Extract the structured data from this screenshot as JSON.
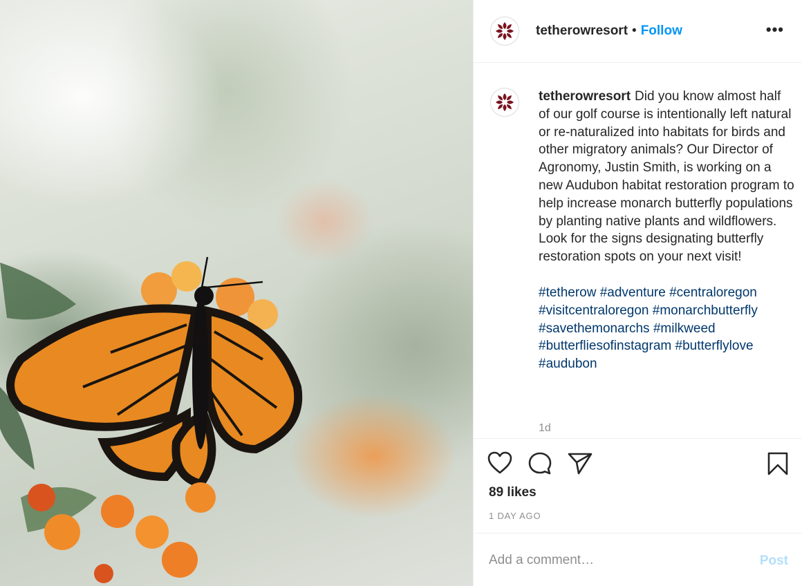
{
  "post": {
    "image_alt": "Monarch butterfly on orange milkweed flowers",
    "brand_color": "#7a1420"
  },
  "header": {
    "username": "tetherowresort",
    "separator": "•",
    "follow_label": "Follow",
    "more_label": "•••"
  },
  "caption": {
    "username": "tetherowresort",
    "text": "Did you know almost half of our golf course is intentionally left natural or re-naturalized into habitats for birds and other migratory animals? Our Director of Agronomy, Justin Smith, is working on a new Audubon habitat restoration program to help increase monarch butterfly populations by planting native plants and wildflowers. Look for the signs designating butterfly restoration spots on your next visit!",
    "hashtags": [
      "#tetherow",
      "#adventure",
      "#centraloregon",
      "#visitcentraloregon",
      "#monarchbutterfly",
      "#savethemonarchs",
      "#milkweed",
      "#butterfliesofinstagram",
      "#butterflylove",
      "#audubon"
    ],
    "time_ago": "1d"
  },
  "actions": {
    "icons": [
      "heart-icon",
      "comment-icon",
      "share-icon",
      "bookmark-icon"
    ],
    "likes": "89 likes",
    "date": "1 DAY AGO"
  },
  "comment": {
    "placeholder": "Add a comment…",
    "post_label": "Post"
  }
}
